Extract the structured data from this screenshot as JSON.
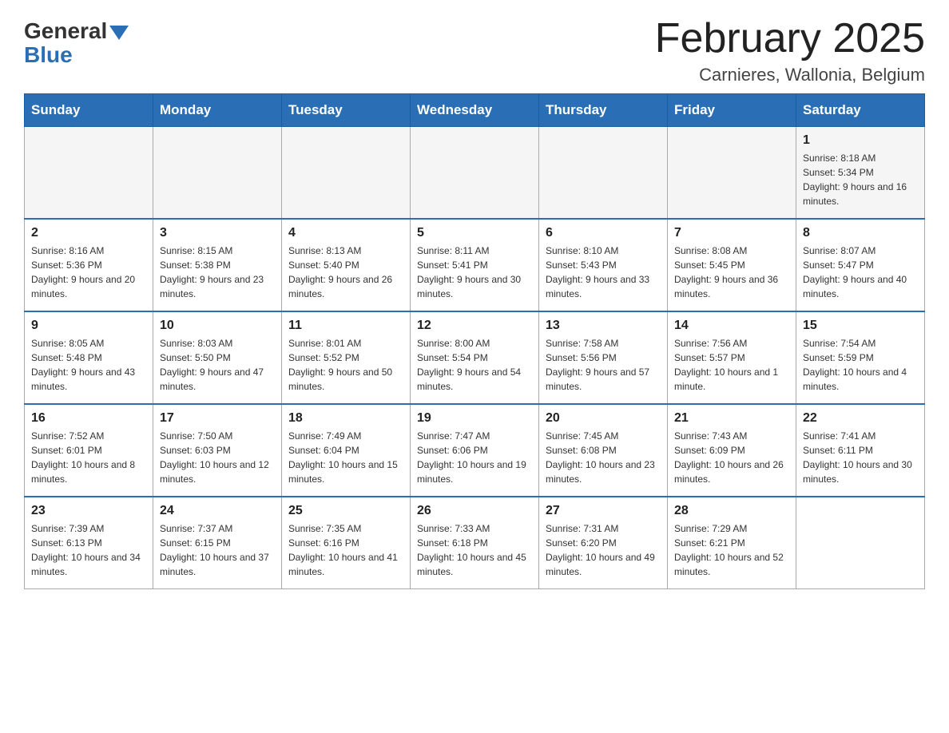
{
  "logo": {
    "text_general": "General",
    "text_blue": "Blue"
  },
  "header": {
    "title": "February 2025",
    "subtitle": "Carnieres, Wallonia, Belgium"
  },
  "days_of_week": [
    "Sunday",
    "Monday",
    "Tuesday",
    "Wednesday",
    "Thursday",
    "Friday",
    "Saturday"
  ],
  "weeks": [
    [
      {
        "day": "",
        "info": ""
      },
      {
        "day": "",
        "info": ""
      },
      {
        "day": "",
        "info": ""
      },
      {
        "day": "",
        "info": ""
      },
      {
        "day": "",
        "info": ""
      },
      {
        "day": "",
        "info": ""
      },
      {
        "day": "1",
        "info": "Sunrise: 8:18 AM\nSunset: 5:34 PM\nDaylight: 9 hours and 16 minutes."
      }
    ],
    [
      {
        "day": "2",
        "info": "Sunrise: 8:16 AM\nSunset: 5:36 PM\nDaylight: 9 hours and 20 minutes."
      },
      {
        "day": "3",
        "info": "Sunrise: 8:15 AM\nSunset: 5:38 PM\nDaylight: 9 hours and 23 minutes."
      },
      {
        "day": "4",
        "info": "Sunrise: 8:13 AM\nSunset: 5:40 PM\nDaylight: 9 hours and 26 minutes."
      },
      {
        "day": "5",
        "info": "Sunrise: 8:11 AM\nSunset: 5:41 PM\nDaylight: 9 hours and 30 minutes."
      },
      {
        "day": "6",
        "info": "Sunrise: 8:10 AM\nSunset: 5:43 PM\nDaylight: 9 hours and 33 minutes."
      },
      {
        "day": "7",
        "info": "Sunrise: 8:08 AM\nSunset: 5:45 PM\nDaylight: 9 hours and 36 minutes."
      },
      {
        "day": "8",
        "info": "Sunrise: 8:07 AM\nSunset: 5:47 PM\nDaylight: 9 hours and 40 minutes."
      }
    ],
    [
      {
        "day": "9",
        "info": "Sunrise: 8:05 AM\nSunset: 5:48 PM\nDaylight: 9 hours and 43 minutes."
      },
      {
        "day": "10",
        "info": "Sunrise: 8:03 AM\nSunset: 5:50 PM\nDaylight: 9 hours and 47 minutes."
      },
      {
        "day": "11",
        "info": "Sunrise: 8:01 AM\nSunset: 5:52 PM\nDaylight: 9 hours and 50 minutes."
      },
      {
        "day": "12",
        "info": "Sunrise: 8:00 AM\nSunset: 5:54 PM\nDaylight: 9 hours and 54 minutes."
      },
      {
        "day": "13",
        "info": "Sunrise: 7:58 AM\nSunset: 5:56 PM\nDaylight: 9 hours and 57 minutes."
      },
      {
        "day": "14",
        "info": "Sunrise: 7:56 AM\nSunset: 5:57 PM\nDaylight: 10 hours and 1 minute."
      },
      {
        "day": "15",
        "info": "Sunrise: 7:54 AM\nSunset: 5:59 PM\nDaylight: 10 hours and 4 minutes."
      }
    ],
    [
      {
        "day": "16",
        "info": "Sunrise: 7:52 AM\nSunset: 6:01 PM\nDaylight: 10 hours and 8 minutes."
      },
      {
        "day": "17",
        "info": "Sunrise: 7:50 AM\nSunset: 6:03 PM\nDaylight: 10 hours and 12 minutes."
      },
      {
        "day": "18",
        "info": "Sunrise: 7:49 AM\nSunset: 6:04 PM\nDaylight: 10 hours and 15 minutes."
      },
      {
        "day": "19",
        "info": "Sunrise: 7:47 AM\nSunset: 6:06 PM\nDaylight: 10 hours and 19 minutes."
      },
      {
        "day": "20",
        "info": "Sunrise: 7:45 AM\nSunset: 6:08 PM\nDaylight: 10 hours and 23 minutes."
      },
      {
        "day": "21",
        "info": "Sunrise: 7:43 AM\nSunset: 6:09 PM\nDaylight: 10 hours and 26 minutes."
      },
      {
        "day": "22",
        "info": "Sunrise: 7:41 AM\nSunset: 6:11 PM\nDaylight: 10 hours and 30 minutes."
      }
    ],
    [
      {
        "day": "23",
        "info": "Sunrise: 7:39 AM\nSunset: 6:13 PM\nDaylight: 10 hours and 34 minutes."
      },
      {
        "day": "24",
        "info": "Sunrise: 7:37 AM\nSunset: 6:15 PM\nDaylight: 10 hours and 37 minutes."
      },
      {
        "day": "25",
        "info": "Sunrise: 7:35 AM\nSunset: 6:16 PM\nDaylight: 10 hours and 41 minutes."
      },
      {
        "day": "26",
        "info": "Sunrise: 7:33 AM\nSunset: 6:18 PM\nDaylight: 10 hours and 45 minutes."
      },
      {
        "day": "27",
        "info": "Sunrise: 7:31 AM\nSunset: 6:20 PM\nDaylight: 10 hours and 49 minutes."
      },
      {
        "day": "28",
        "info": "Sunrise: 7:29 AM\nSunset: 6:21 PM\nDaylight: 10 hours and 52 minutes."
      },
      {
        "day": "",
        "info": ""
      }
    ]
  ]
}
